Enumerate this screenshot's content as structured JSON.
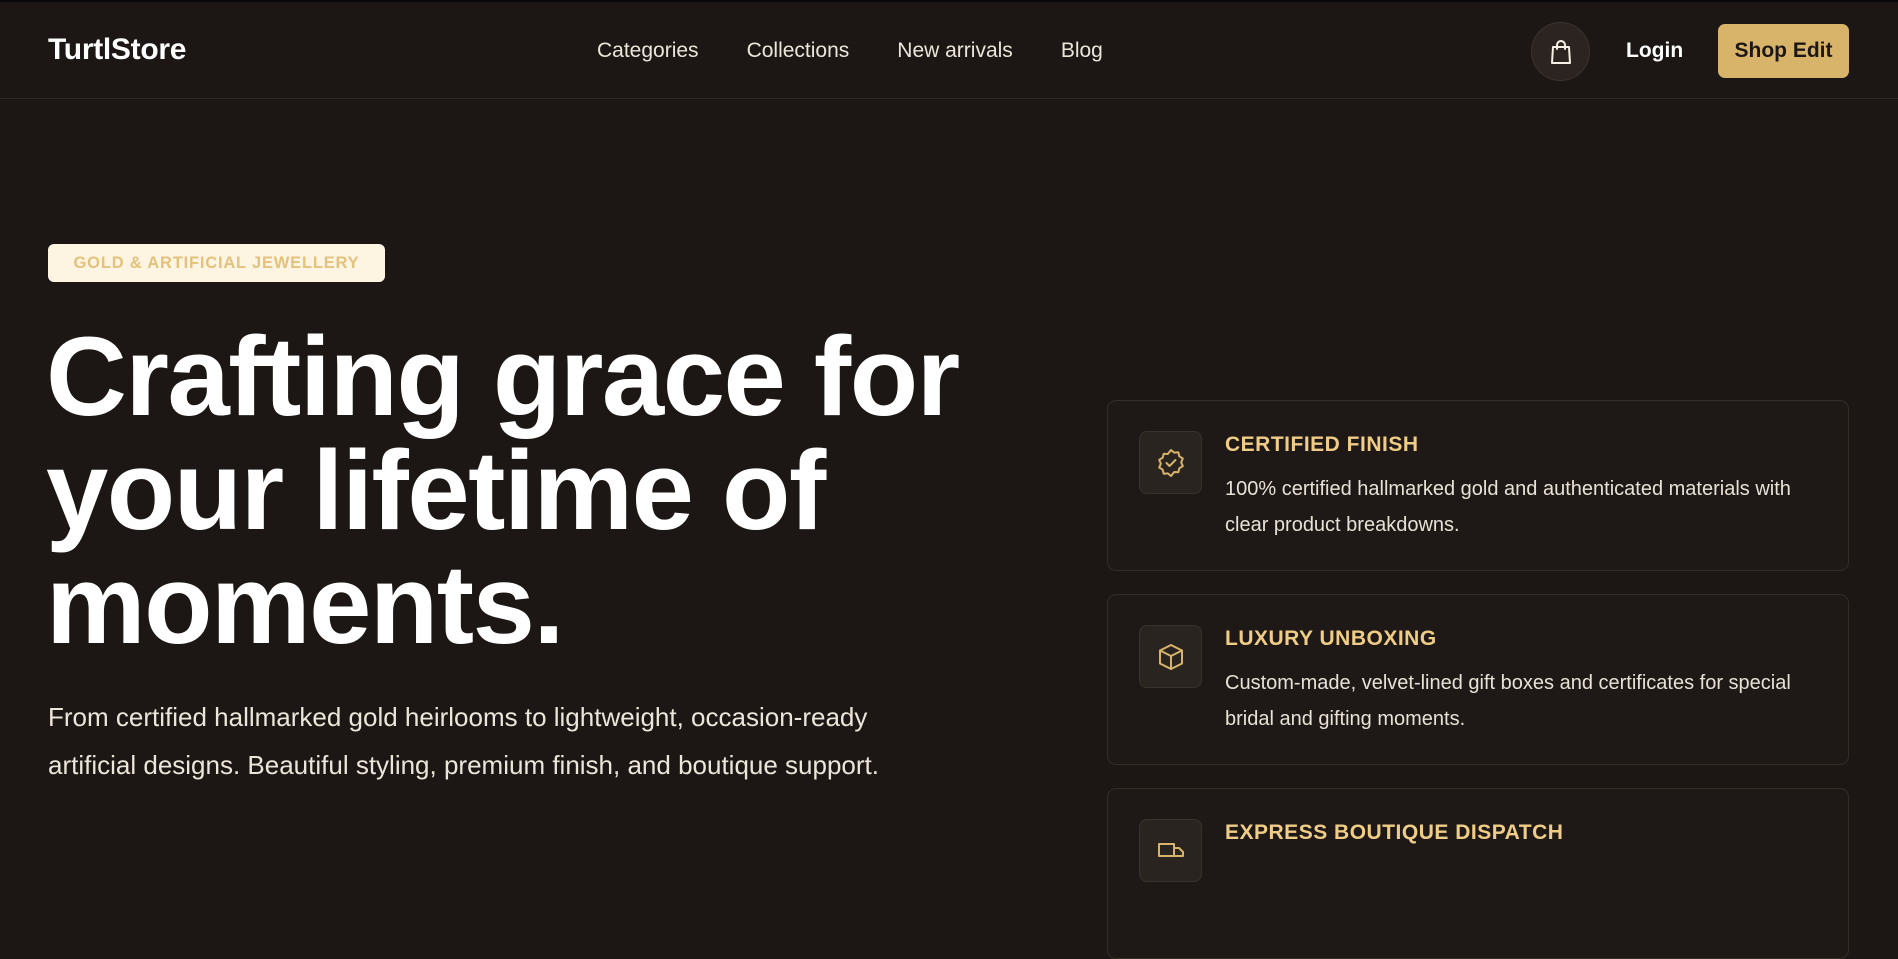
{
  "header": {
    "logo": "TurtlStore",
    "nav": [
      "Categories",
      "Collections",
      "New arrivals",
      "Blog"
    ],
    "cart_icon": "shopping-bag-icon",
    "login_label": "Login",
    "cta_label": "Shop Edit"
  },
  "hero": {
    "badge": "GOLD & ARTIFICIAL JEWELLERY",
    "title": "Crafting grace for your lifetime of moments.",
    "lead": "From certified hallmarked gold heirlooms to lightweight, occasion-ready artificial designs. Beautiful styling, premium finish, and boutique support."
  },
  "features": [
    {
      "icon": "certified-badge-icon",
      "title": "CERTIFIED FINISH",
      "description": "100% certified hallmarked gold and authenticated materials with clear product breakdowns."
    },
    {
      "icon": "box-icon",
      "title": "LUXURY UNBOXING",
      "description": "Custom-made, velvet-lined gift boxes and certificates for special bridal and gifting moments."
    },
    {
      "icon": "truck-icon",
      "title": "EXPRESS BOUTIQUE DISPATCH",
      "description": ""
    }
  ],
  "colors": {
    "background": "#1c1715",
    "accent": "#d8b46a",
    "accent_text": "#f0cd87"
  }
}
